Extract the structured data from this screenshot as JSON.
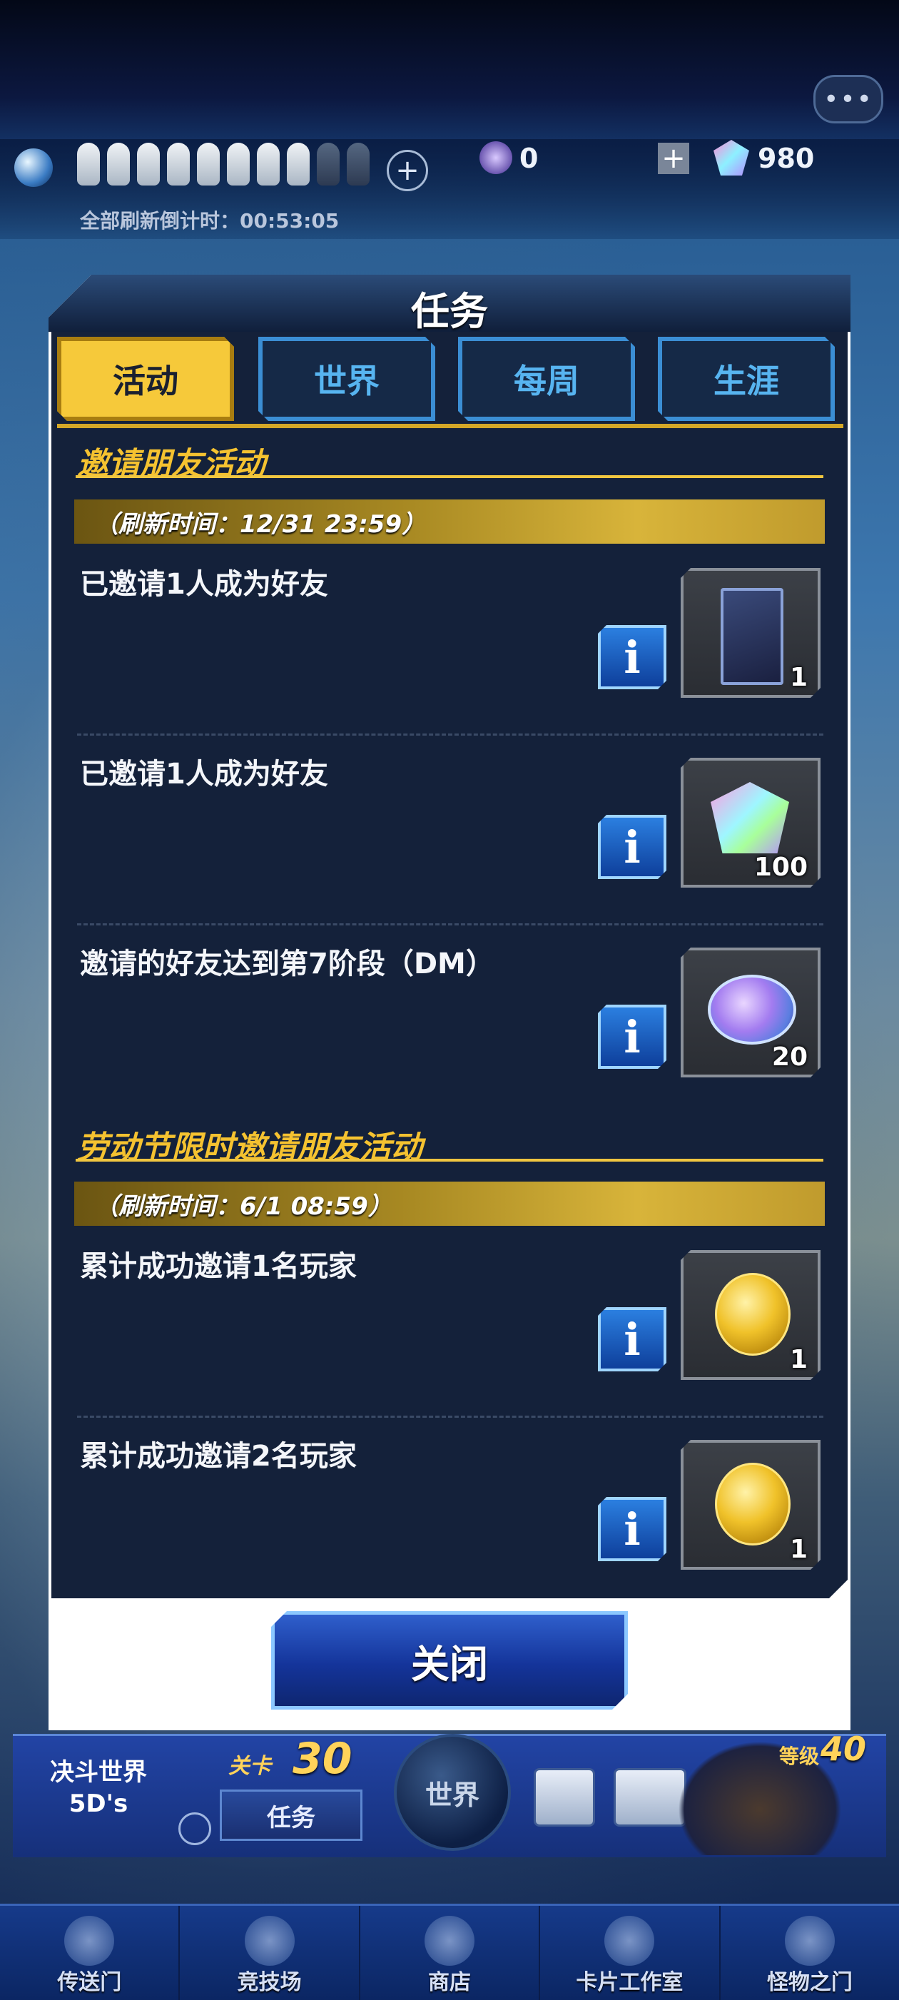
{
  "status": {
    "gem_icon_count": "0",
    "gems": "980",
    "refresh_timer": "全部刷新倒计时：00:53:05"
  },
  "modal": {
    "title": "任务",
    "tabs": [
      "活动",
      "世界",
      "每周",
      "生涯"
    ],
    "active_tab": "活动",
    "close_label": "关闭"
  },
  "sections": [
    {
      "title": "邀请朋友活动",
      "refresh": "（刷新时间：12/31 23:59）",
      "quests": [
        {
          "text": "已邀请1人成为好友",
          "reward_icon": "card-pack-icon",
          "reward_count": "1"
        },
        {
          "text": "已邀请1人成为好友",
          "reward_icon": "gem-icon",
          "reward_count": "100"
        },
        {
          "text": "邀请的好友达到第7阶段（DM）",
          "reward_icon": "token-icon",
          "reward_count": "20"
        }
      ]
    },
    {
      "title": "劳动节限时邀请朋友活动",
      "refresh": "（刷新时间：6/1 08:59）",
      "quests": [
        {
          "text": "累计成功邀请1名玩家",
          "reward_icon": "gold-coin-icon",
          "reward_count": "1"
        },
        {
          "text": "累计成功邀请2名玩家",
          "reward_icon": "gold-coin-icon",
          "reward_count": "1"
        }
      ]
    }
  ],
  "world": {
    "name_line1": "决斗世界",
    "name_line2": "5D's",
    "stage_label": "关卡",
    "stage_num": "30",
    "quest_button": "任务",
    "world_button": "世界",
    "level_label": "等级",
    "level_num": "40"
  },
  "nav": [
    "传送门",
    "竞技场",
    "商店",
    "卡片工作室",
    "怪物之门"
  ],
  "colors": {
    "accent": "#f6c93a",
    "tab_inactive_text": "#57b4f0",
    "panel": "#14213a"
  }
}
